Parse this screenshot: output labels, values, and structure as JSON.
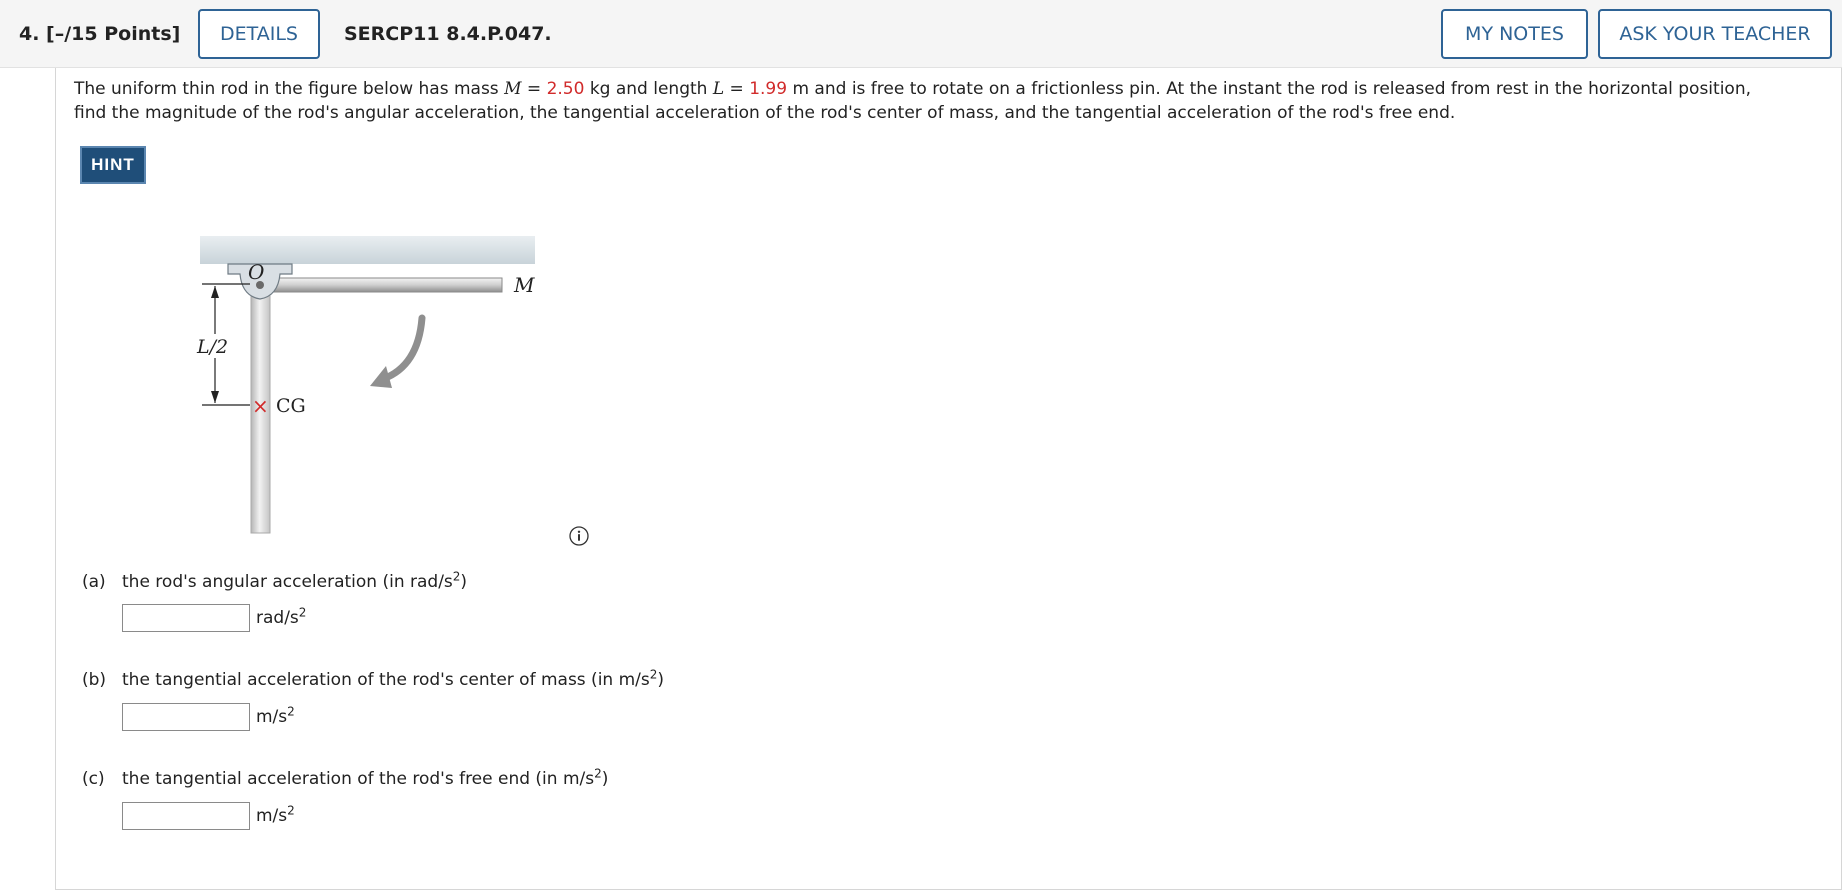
{
  "header": {
    "question_number": "4. [–/15 Points]",
    "details_label": "DETAILS",
    "problem_code": "SERCP11 8.4.P.047.",
    "my_notes_label": "MY NOTES",
    "ask_teacher_label": "ASK YOUR TEACHER"
  },
  "problem": {
    "text_1": "The uniform thin rod in the figure below has mass ",
    "mass_var": "M",
    "eq1": " = ",
    "mass_value": "2.50",
    "text_2": " kg and length ",
    "length_var": "L",
    "eq2": " = ",
    "length_value": "1.99",
    "text_3": " m and is free to rotate on a frictionless pin. At the instant the rod is released from rest in the horizontal position, find the magnitude of the rod's angular acceleration, the tangential acceleration of the rod's center of mass, and the tangential acceleration of the rod's free end."
  },
  "hint_label": "HINT",
  "figure": {
    "pivot_label": "O",
    "mass_label": "M",
    "half_length_label": "L/2",
    "cg_marker": "×",
    "cg_label": "CG"
  },
  "parts": [
    {
      "letter": "(a)",
      "text": "the rod's angular acceleration (in rad/s",
      "text_sup": "2",
      "text_end": ")",
      "input_value": "",
      "unit": "rad/s",
      "unit_sup": "2"
    },
    {
      "letter": "(b)",
      "text": "the tangential acceleration of the rod's center of mass (in m/s",
      "text_sup": "2",
      "text_end": ")",
      "input_value": "",
      "unit": "m/s",
      "unit_sup": "2"
    },
    {
      "letter": "(c)",
      "text": "the tangential acceleration of the rod's free end (in m/s",
      "text_sup": "2",
      "text_end": ")",
      "input_value": "",
      "unit": "m/s",
      "unit_sup": "2"
    }
  ],
  "colors": {
    "accent": "#2e6395",
    "given_value": "#d12b2b",
    "hint_bg": "#1f4e79"
  },
  "icons": {
    "info": "info-circle-icon",
    "rotation_arrow": "curved-arrow-icon"
  }
}
